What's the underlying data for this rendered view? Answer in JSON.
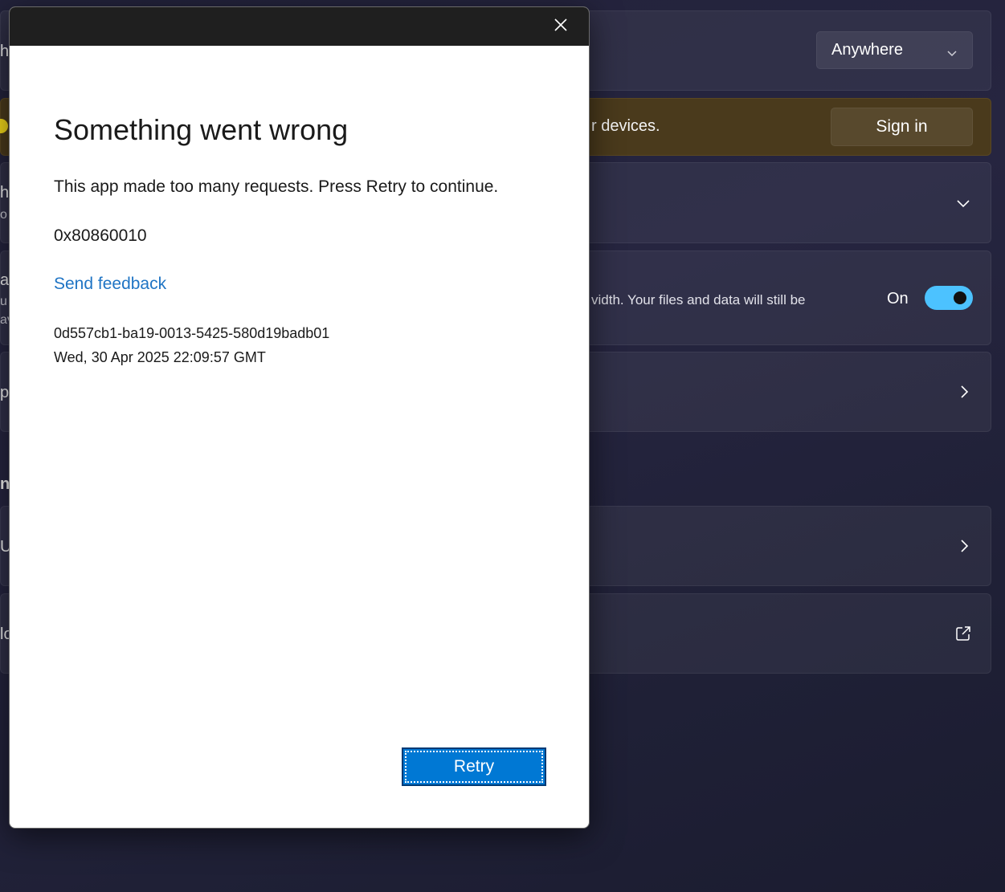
{
  "background": {
    "location_dropdown": {
      "value": "Anywhere",
      "icon": "chevron-down-icon"
    },
    "signin_banner": {
      "text_fragment": "r devices.",
      "button_label": "Sign in",
      "accent_color": "#f0d51a",
      "background_color": "#4a3a1c"
    },
    "expand_row": {
      "icon": "chevron-down-icon"
    },
    "toggle_row": {
      "description_fragment": "vidth. Your files and data will still be",
      "toggle_label": "On",
      "toggle_state": true,
      "toggle_color": "#4cc2ff"
    },
    "nav_row_1": {
      "icon": "chevron-right-icon"
    },
    "nav_row_2": {
      "icon": "chevron-right-icon"
    },
    "external_row": {
      "icon": "open-external-icon"
    },
    "edge_fragments": [
      "h",
      "h",
      "o",
      "ar",
      "u",
      "av",
      "p",
      "nt",
      "Un",
      "lo"
    ]
  },
  "dialog": {
    "close_icon": "close-icon",
    "heading": "Something went wrong",
    "message": "This app made too many requests. Press Retry to continue.",
    "error_code": "0x80860010",
    "feedback_link": "Send feedback",
    "correlation_id": "0d557cb1-ba19-0013-5425-580d19badb01",
    "timestamp": "Wed, 30 Apr 2025 22:09:57 GMT",
    "retry_label": "Retry",
    "link_color": "#1f74c4",
    "button_color": "#0078d4"
  }
}
